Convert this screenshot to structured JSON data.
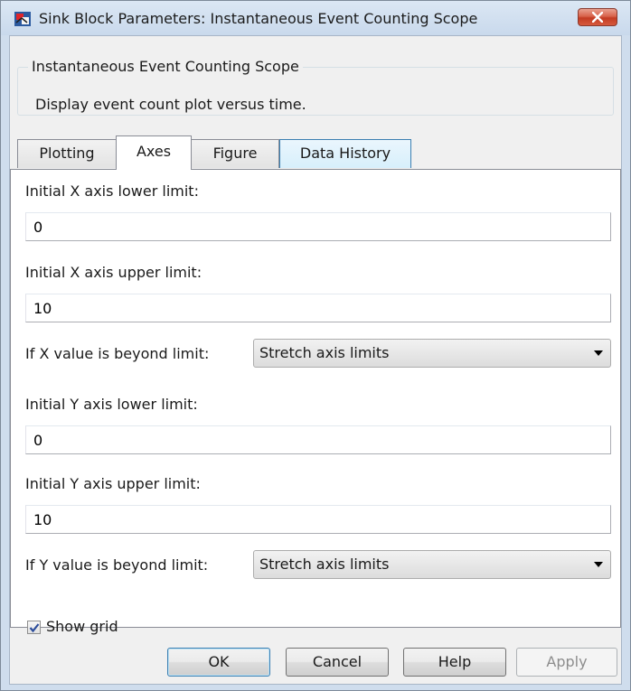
{
  "window": {
    "title": "Sink Block Parameters: Instantaneous Event Counting Scope"
  },
  "block": {
    "group_title": "Instantaneous Event Counting Scope",
    "description": "Display event count plot versus time."
  },
  "tabs": [
    {
      "label": "Plotting",
      "state": "normal"
    },
    {
      "label": "Axes",
      "state": "selected"
    },
    {
      "label": "Figure",
      "state": "normal"
    },
    {
      "label": "Data History",
      "state": "hover"
    }
  ],
  "axes": {
    "x_lower_label": "Initial X axis lower limit:",
    "x_lower_value": "0",
    "x_upper_label": "Initial X axis upper limit:",
    "x_upper_value": "10",
    "x_beyond_label": "If X value is beyond limit:",
    "x_beyond_value": "Stretch axis limits",
    "y_lower_label": "Initial Y axis lower limit:",
    "y_lower_value": "0",
    "y_upper_label": "Initial Y axis upper limit:",
    "y_upper_value": "10",
    "y_beyond_label": "If Y value is beyond limit:",
    "y_beyond_value": "Stretch axis limits",
    "show_grid_label": "Show grid",
    "show_grid_checked": true
  },
  "buttons": {
    "ok": "OK",
    "cancel": "Cancel",
    "help": "Help",
    "apply": "Apply"
  },
  "icons": {
    "app": "simulink-block-icon",
    "close": "close-icon",
    "dropdown": "chevron-down-icon",
    "check": "checkmark-icon"
  },
  "colors": {
    "close_button": "#c33b22",
    "tab_hover": "#d7effc"
  }
}
